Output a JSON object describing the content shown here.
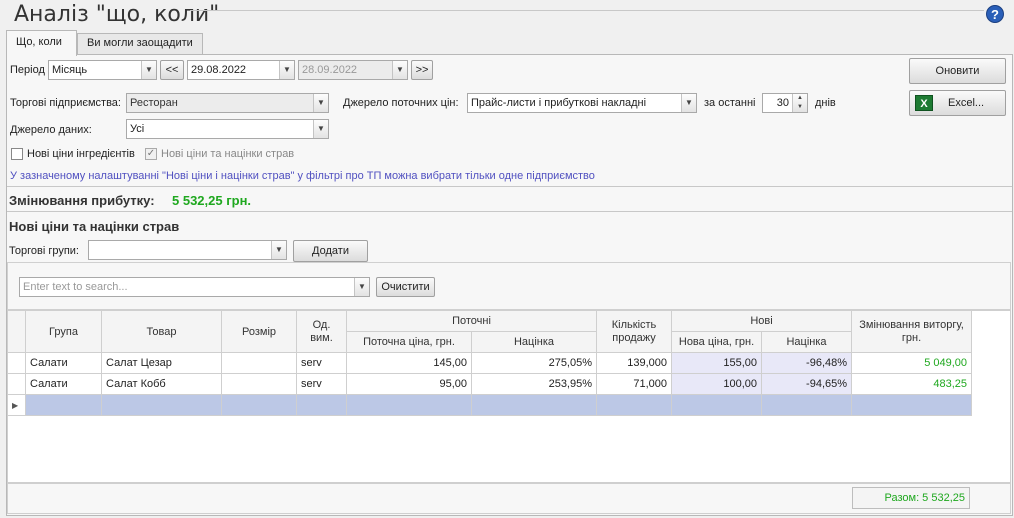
{
  "window": {
    "title": "Аналіз \"що, коли\"",
    "help": "?"
  },
  "tabs": [
    {
      "label": "Що, коли"
    },
    {
      "label": "Ви могли заощадити"
    }
  ],
  "filters": {
    "period_label": "Період",
    "period_value": "Місяць",
    "prev": "<<",
    "date_from": "29.08.2022",
    "date_to": "28.09.2022",
    "next": ">>",
    "enterprises_label": "Торгові підприємства:",
    "enterprises_value": "Ресторан",
    "data_source_label": "Джерело даних:",
    "data_source_value": "Усі",
    "price_source_label": "Джерело поточних цін:",
    "price_source_value": "Прайс-листи і прибуткові накладні",
    "last_label": "за останні",
    "last_value": "30",
    "days_label": "днів",
    "new_ingredient_prices": "Нові ціни інгредієнтів",
    "new_dish_prices": "Нові ціни та націнки страв",
    "note": "У зазначеному налаштуванні \"Нові ціни і націнки страв\" у фільтрі про ТП можна вибрати тільки одне підприємство"
  },
  "buttons": {
    "refresh": "Оновити",
    "excel": "Excel..."
  },
  "profit": {
    "label": "Змінювання прибутку:",
    "value": "5 532,25 грн."
  },
  "section": {
    "title": "Нові ціни та націнки страв",
    "groups_label": "Торгові групи:",
    "add": "Додати",
    "search_placeholder": "Enter text to search...",
    "clear": "Очистити"
  },
  "table": {
    "headers": {
      "group": "Група",
      "product": "Товар",
      "size": "Розмір",
      "unit": "Од. вим.",
      "current": "Поточні",
      "current_price": "Поточна ціна, грн.",
      "markup": "Націнка",
      "qty": "Кількість продажу",
      "new": "Нові",
      "new_price": "Нова ціна, грн.",
      "new_markup": "Націнка",
      "change": "Змінювання виторгу, грн."
    },
    "rows": [
      {
        "group": "Салати",
        "product": "Салат Цезар",
        "size": "",
        "unit": "serv",
        "price": "145,00",
        "markup": "275,05%",
        "qty": "139,000",
        "new_price": "155,00",
        "new_markup": "-96,48%",
        "change": "5 049,00"
      },
      {
        "group": "Салати",
        "product": "Салат Кобб",
        "size": "",
        "unit": "serv",
        "price": "95,00",
        "markup": "253,95%",
        "qty": "71,000",
        "new_price": "100,00",
        "new_markup": "-94,65%",
        "change": "483,25"
      }
    ],
    "total": "Разом: 5 532,25"
  }
}
